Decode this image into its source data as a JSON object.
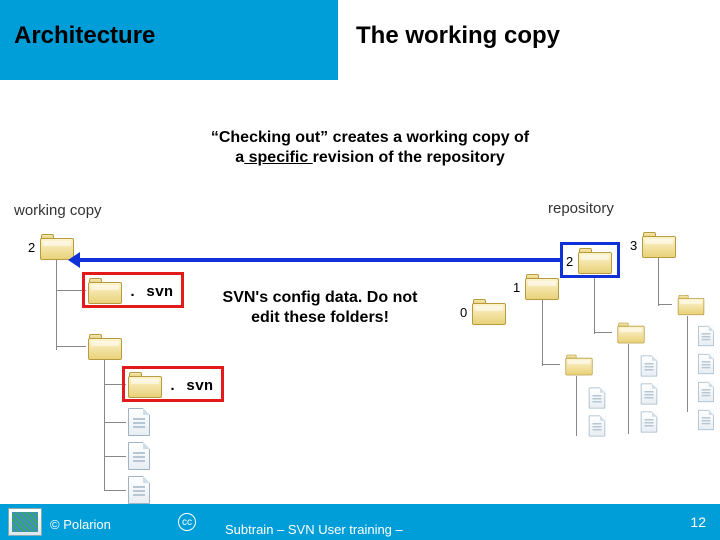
{
  "header": {
    "section": "Architecture",
    "title": "The working copy"
  },
  "subtitle": {
    "line1_pre": "“Checking out” creates a working copy of",
    "line2_pre": "a",
    "line2_underlined": " specific ",
    "line2_post": "revision of the repository"
  },
  "labels": {
    "working_copy": "working copy",
    "repository": "repository"
  },
  "svn_folder_label": ". svn",
  "config_note": "SVN's config data. Do not edit these folders!",
  "revisions": {
    "wc_root": "2",
    "repo_0": "0",
    "repo_1": "1",
    "repo_2": "2",
    "repo_3": "3"
  },
  "footer": {
    "copyright": "© Polarion",
    "cc": "cc",
    "training_line1": "Subtrain – SVN User training –",
    "page": "12"
  }
}
